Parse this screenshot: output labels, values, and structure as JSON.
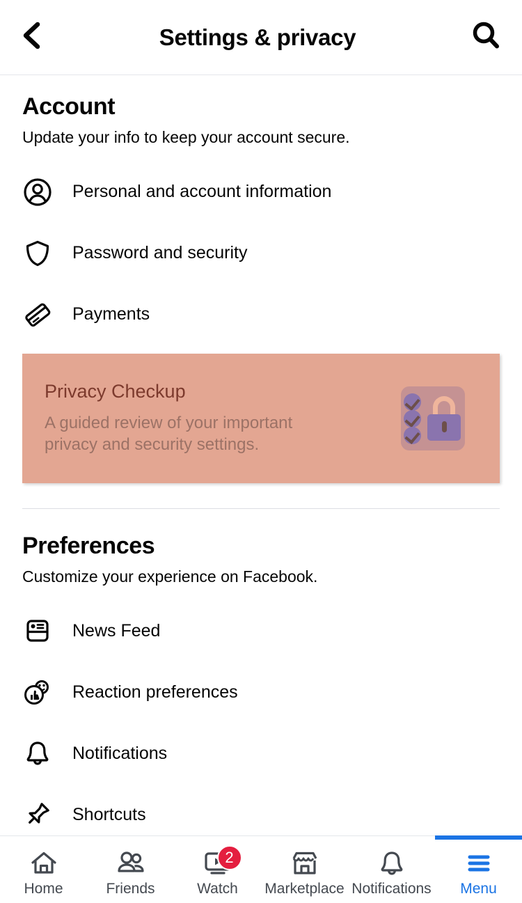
{
  "header": {
    "title": "Settings & privacy",
    "back_icon": "chevron-left-icon",
    "search_icon": "search-icon"
  },
  "sections": [
    {
      "id": "account",
      "title": "Account",
      "subtitle": "Update your info to keep your account secure.",
      "items": [
        {
          "label": "Personal and account information",
          "icon": "person-circle-icon"
        },
        {
          "label": "Password and security",
          "icon": "shield-icon"
        },
        {
          "label": "Payments",
          "icon": "credit-card-icon"
        }
      ]
    },
    {
      "id": "preferences",
      "title": "Preferences",
      "subtitle": "Customize your experience on Facebook.",
      "items": [
        {
          "label": "News Feed",
          "icon": "news-feed-icon"
        },
        {
          "label": "Reaction preferences",
          "icon": "reaction-icon"
        },
        {
          "label": "Notifications",
          "icon": "bell-icon"
        },
        {
          "label": "Shortcuts",
          "icon": "pin-icon"
        }
      ]
    }
  ],
  "privacy_card": {
    "title": "Privacy Checkup",
    "description": "A guided review of your important privacy and security settings.",
    "background_color": "#e3a692",
    "title_color": "#7c3a2d",
    "description_color": "#9c7266",
    "illustration": "privacy-lock-checklist-illustration"
  },
  "bottom_nav": {
    "active": "Menu",
    "accent_color": "#1b74e4",
    "badge_color": "#e41e3f",
    "items": [
      {
        "label": "Home",
        "icon": "home-icon",
        "badge": ""
      },
      {
        "label": "Friends",
        "icon": "friends-icon",
        "badge": ""
      },
      {
        "label": "Watch",
        "icon": "watch-icon",
        "badge": "2"
      },
      {
        "label": "Marketplace",
        "icon": "marketplace-icon",
        "badge": ""
      },
      {
        "label": "Notifications",
        "icon": "bell-icon",
        "badge": ""
      },
      {
        "label": "Menu",
        "icon": "hamburger-menu-icon",
        "badge": ""
      }
    ]
  }
}
